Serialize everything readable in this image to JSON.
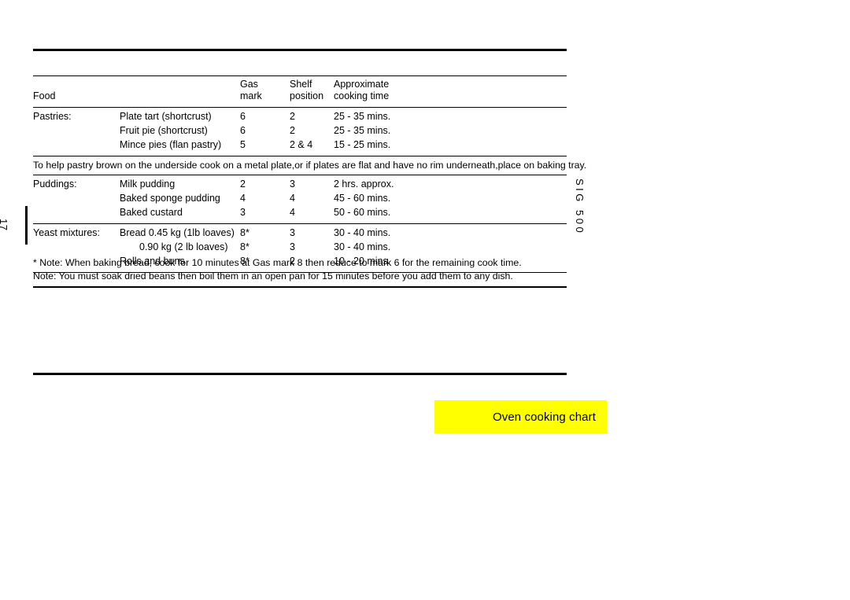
{
  "page": {
    "number": "17",
    "model_mark": "SIG 500"
  },
  "banner": {
    "label": "Oven cooking chart",
    "background_color": "#FFFF00",
    "text_color": "#000000"
  },
  "table": {
    "headers": {
      "food_line1": "",
      "food_line2": "Food",
      "gas_line1": "Gas",
      "gas_line2": "mark",
      "shelf_line1": "Shelf",
      "shelf_line2": "position",
      "time_line1": "Approximate",
      "time_line2": "cooking time"
    },
    "groups": [
      {
        "category": "Pastries:",
        "rows": [
          {
            "item": "Plate tart (shortcrust)",
            "gas_mark": "6",
            "shelf_position": "2",
            "cooking_time": "25 - 35 mins."
          },
          {
            "item": "Fruit pie (shortcrust)",
            "gas_mark": "6",
            "shelf_position": "2",
            "cooking_time": "25 - 35 mins."
          },
          {
            "item": "Mince pies (flan pastry)",
            "gas_mark": "5",
            "shelf_position": "2 & 4",
            "cooking_time": "15 - 25 mins."
          }
        ]
      },
      {
        "category": "Puddings:",
        "rows": [
          {
            "item": "Milk pudding",
            "gas_mark": "2",
            "shelf_position": "3",
            "cooking_time": "2 hrs. approx."
          },
          {
            "item": "Baked sponge pudding",
            "gas_mark": "4",
            "shelf_position": "4",
            "cooking_time": "45 - 60 mins."
          },
          {
            "item": "Baked custard",
            "gas_mark": "3",
            "shelf_position": "4",
            "cooking_time": "50 - 60 mins."
          }
        ]
      },
      {
        "category": "Yeast mixtures:",
        "rows": [
          {
            "item": "Bread  0.45 kg (1lb loaves)",
            "gas_mark": "8*",
            "shelf_position": "3",
            "cooking_time": "30 - 40 mins."
          },
          {
            "item": "0.90 kg (2 lb loaves)",
            "gas_mark": "8*",
            "shelf_position": "3",
            "cooking_time": "30 - 40 mins."
          },
          {
            "item": "Rolls and buns",
            "gas_mark": "8*",
            "shelf_position": "2",
            "cooking_time": "10 - 20 mins."
          }
        ]
      }
    ],
    "inline_note": "To help pastry brown on the underside cook on a metal plate,or if plates are flat and have no rim underneath,place on baking tray."
  },
  "footnotes": [
    "* Note: When baking bread, cook for 10 minutes at Gas mark 8 then reduce to mark 6 for the remaining cook time.",
    "Note: You must soak dried beans then boil them in an open pan for 15 minutes before you add them to any dish."
  ]
}
